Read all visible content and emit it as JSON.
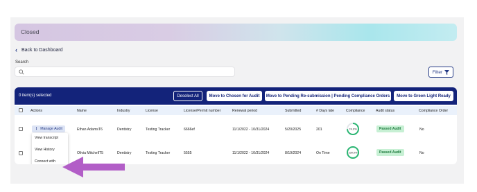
{
  "banner": {
    "title": "Closed"
  },
  "nav": {
    "back_label": "Back to Dashboard"
  },
  "search": {
    "label": "Search",
    "placeholder": ""
  },
  "filter": {
    "label": "Filter"
  },
  "action_bar": {
    "selected_text": "0 item(s) selected",
    "deselect_label": "Deselect All",
    "move_chosen_label": "Move to Chosen for Audit",
    "move_pending_label": "Move to Pending Re-submission | Pending Compliance Orders",
    "move_green_label": "Move to Green Light Ready"
  },
  "table": {
    "columns": [
      "Actions",
      "Name",
      "Industry",
      "License",
      "License/Permit number",
      "Renewal period",
      "Submitted",
      "# Days late",
      "Compliance",
      "Audit status",
      "Compliance Order"
    ],
    "rows": [
      {
        "action": "Manage Audit",
        "name": "Ethan AdamsT6",
        "industry": "Dentistry",
        "license": "Testing Tracker",
        "permit": "6666ef",
        "renewal": "11/1/2022 - 10/31/2024",
        "submitted": "5/20/2025",
        "days_late": "201",
        "compliance": "74.0%",
        "compliance_value": 74,
        "audit_status": "Passed Audit",
        "order": "No"
      },
      {
        "name": "Olivia MitchellT5",
        "industry": "Dentistry",
        "license": "Testing Tracker",
        "permit": "5555",
        "renewal": "11/1/2022 - 10/31/2024",
        "submitted": "8/19/2024",
        "days_late": "On Time",
        "compliance": "100.0%",
        "compliance_value": 100,
        "audit_status": "Passed Audit",
        "order": "No"
      }
    ]
  },
  "dropdown": {
    "items": [
      "View transcript",
      "View History",
      "Connect with",
      "professional"
    ]
  },
  "colors": {
    "navy": "#13237a",
    "accent": "#263b86",
    "success": "#1d7a3c",
    "ring": "#2bb673",
    "arrow": "#b25ec7"
  },
  "icons": [
    "chevron-left-icon",
    "search-icon",
    "filter-icon",
    "kebab-icon",
    "arrow-annotation-icon"
  ]
}
